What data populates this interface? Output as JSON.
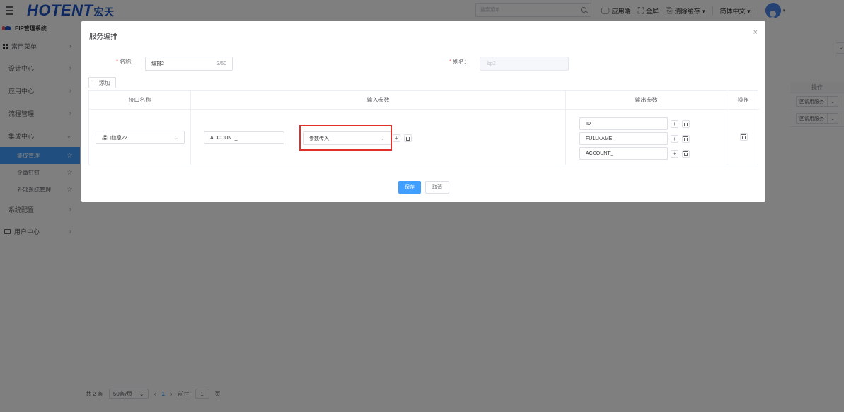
{
  "header": {
    "logo_main": "HOTENT",
    "logo_cn": "宏天",
    "search_placeholder": "搜索菜单",
    "actions": [
      {
        "icon": "monitor-icon",
        "label": "应用端"
      },
      {
        "icon": "fullscreen-icon",
        "label": "全屏"
      },
      {
        "icon": "clear-cache-icon",
        "label": "清除缓存 ▾"
      }
    ],
    "language": "简体中文 ▾"
  },
  "sidebar": {
    "system_title": "EIP管理系统",
    "common_menu": "常用菜单",
    "items": [
      {
        "label": "设计中心"
      },
      {
        "label": "应用中心"
      },
      {
        "label": "流程管理"
      },
      {
        "label": "集成中心"
      }
    ],
    "sub_items": [
      {
        "label": "集成管理"
      },
      {
        "label": "企微钉钉"
      },
      {
        "label": "外部系统管理"
      }
    ],
    "bottom_items": [
      {
        "label": "系统配置"
      },
      {
        "label": "用户中心"
      }
    ]
  },
  "background_page": {
    "column_header": "操作",
    "row_action": "回调用服务",
    "pager": {
      "total": "共 2 条",
      "page_size": "50条/页",
      "current_page": "1",
      "goto_label": "前往",
      "goto_value": "1",
      "page_unit": "页"
    }
  },
  "dialog": {
    "title": "服务编排",
    "close": "×",
    "name_label": "名称:",
    "name_value": "编排2",
    "name_count": "3/50",
    "alias_label": "别名:",
    "alias_value": "bp2",
    "add_button": "+ 添加",
    "table": {
      "headers": [
        "接口名称",
        "输入参数",
        "输出参数",
        "操作"
      ],
      "row": {
        "interface_name": "接口信息22",
        "input_param_name": "ACCOUNT_",
        "input_param_source": "参数传入",
        "output_params": [
          "ID_",
          "FULLNAME_",
          "ACCOUNT_"
        ]
      }
    },
    "save_button": "保存",
    "cancel_button": "取消"
  },
  "colors": {
    "brand": "#1d52c4",
    "primary": "#409eff",
    "highlight": "#e0302a"
  }
}
